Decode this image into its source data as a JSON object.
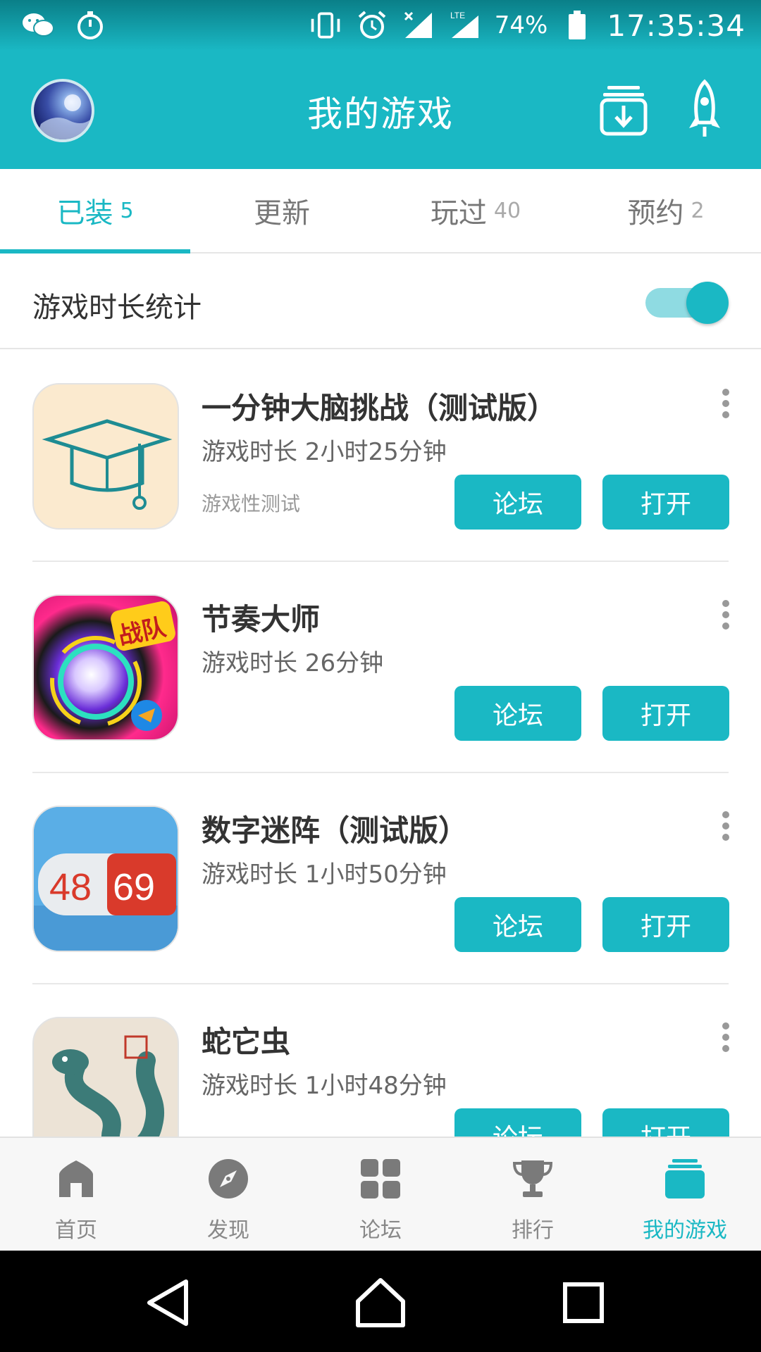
{
  "status_bar": {
    "battery": "74%",
    "time": "17:35:34",
    "network": "LTE",
    "left_icons": [
      "wechat-icon",
      "stopwatch-icon"
    ],
    "right_icons": [
      "vibrate-icon",
      "alarm-icon",
      "signal-icon",
      "lte-signal-icon",
      "battery-icon"
    ]
  },
  "app_bar": {
    "title": "我的游戏",
    "avatar": "avatar",
    "actions": [
      "download-icon",
      "rocket-icon"
    ]
  },
  "tabs": [
    {
      "label": "已装",
      "count": "5",
      "active": true
    },
    {
      "label": "更新",
      "count": "",
      "active": false
    },
    {
      "label": "玩过",
      "count": "40",
      "active": false
    },
    {
      "label": "预约",
      "count": "2",
      "active": false
    }
  ],
  "stats": {
    "label": "游戏时长统计",
    "toggle_on": true
  },
  "games": [
    {
      "title": "一分钟大脑挑战（测试版）",
      "time": "游戏时长 2小时25分钟",
      "tag": "游戏性测试",
      "forum_label": "论坛",
      "open_label": "打开"
    },
    {
      "title": "节奏大师",
      "time": "游戏时长 26分钟",
      "tag": "",
      "forum_label": "论坛",
      "open_label": "打开",
      "icon_text": "战队"
    },
    {
      "title": "数字迷阵（测试版）",
      "time": "游戏时长 1小时50分钟",
      "tag": "",
      "forum_label": "论坛",
      "open_label": "打开",
      "icon_left": "48",
      "icon_right": "69"
    },
    {
      "title": "蛇它虫",
      "time": "游戏时长 1小时48分钟",
      "tag": "",
      "forum_label": "论坛",
      "open_label": "打开"
    }
  ],
  "bottom_nav": [
    {
      "label": "首页",
      "icon": "home-icon",
      "active": false
    },
    {
      "label": "发现",
      "icon": "compass-icon",
      "active": false
    },
    {
      "label": "论坛",
      "icon": "grid-icon",
      "active": false
    },
    {
      "label": "排行",
      "icon": "trophy-icon",
      "active": false
    },
    {
      "label": "我的游戏",
      "icon": "stack-icon",
      "active": true
    }
  ],
  "colors": {
    "accent": "#1ab8c4",
    "text_primary": "#333333",
    "text_secondary": "#666666",
    "nav_inactive": "#888888"
  },
  "system_nav": [
    "back-icon",
    "home-nav-icon",
    "recents-icon"
  ]
}
